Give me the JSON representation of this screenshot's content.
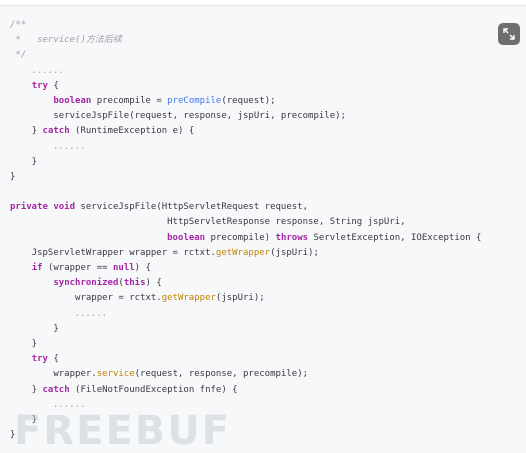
{
  "colors": {
    "background": "#f6f8fa",
    "comment": "#a0a1a7",
    "keyword": "#a626a4",
    "function": "#4078f2",
    "method_call": "#c18401",
    "text": "#383a42",
    "expand_button": "#6f6f6f"
  },
  "toolbar": {
    "expand_icon": "expand-icon"
  },
  "code": {
    "l1": "/**",
    "l2": " *   service()方法后续",
    "l3": " */",
    "l4": "    ......",
    "l5_kw": "try",
    "l5_rest": " {",
    "l6_kw": "boolean",
    "l6_rest": " precompile = ",
    "l6_fn": "preCompile",
    "l6_end": "(request);",
    "l7_fn": "serviceJspFile",
    "l7_rest": "(request, response, jspUri, precompile);",
    "l8_a": "} ",
    "l8_kw": "catch",
    "l8_rest": " (RuntimeException e) {",
    "l9": "        ......",
    "l10": "    }",
    "l11": "}",
    "l12": "",
    "l13_kw": "private void",
    "l13_sp": " ",
    "l13_fn": "serviceJspFile",
    "l13_rest": "(HttpServletRequest request,",
    "l14": "                             HttpServletResponse response, String jspUri,",
    "l15_kw": "boolean",
    "l15_rest": " precompile) ",
    "l15_kw2": "throws",
    "l15_end": " ServletException, IOException {",
    "l16_a": "    JspServletWrapper wrapper = rctxt.",
    "l16_call": "getWrapper",
    "l16_b": "(jspUri);",
    "l17_kw": "if",
    "l17_a": " (wrapper == ",
    "l17_kw2": "null",
    "l17_b": ") {",
    "l18_kw": "synchronized",
    "l18_a": "(",
    "l18_kw2": "this",
    "l18_b": ") {",
    "l19_a": "            wrapper = rctxt.",
    "l19_call": "getWrapper",
    "l19_b": "(jspUri);",
    "l20": "            ......",
    "l21": "        }",
    "l22": "    }",
    "l23_kw": "try",
    "l23_rest": " {",
    "l24_a": "        wrapper.",
    "l24_call": "service",
    "l24_b": "(request, response, precompile);",
    "l25_a": "    } ",
    "l25_kw": "catch",
    "l25_rest": " (FileNotFoundException fnfe) {",
    "l26": "        ......",
    "l27": "    }",
    "l28": "}"
  },
  "watermark": {
    "text": "FREEBUF"
  }
}
